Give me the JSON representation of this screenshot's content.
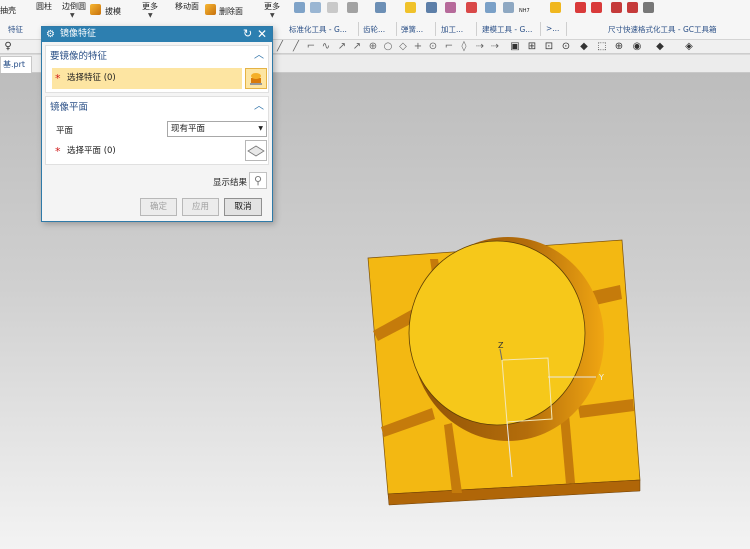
{
  "ribbon": {
    "items": {
      "shell": "抽壳",
      "cylinder": "圆柱",
      "edge_blend": "边倒圆",
      "draft": "拔模",
      "more1": "更多",
      "move_face": "移动面",
      "delete_face": "删除面",
      "more2": "更多"
    },
    "groups": {
      "feature": "特征",
      "std_tools": "标准化工具 - G...",
      "gear": "齿轮...",
      "spring": "弹簧...",
      "machining": "加工...",
      "modeling_tools": "建模工具 - G...",
      "overflow": ">...",
      "dim_format": "尺寸快速格式化工具 - GC工具箱"
    },
    "icon_text": {
      "nh": "NH7"
    }
  },
  "tab": {
    "file_label": "基.prt"
  },
  "dialog": {
    "title": "镜像特征",
    "section1": {
      "title": "要镜像的特征",
      "select_label": "选择特征 (0)"
    },
    "section2": {
      "title": "镜像平面",
      "plane_label": "平面",
      "plane_value": "现有平面",
      "select_plane_label": "选择平面 (0)"
    },
    "show_result": "显示结果",
    "buttons": {
      "ok": "确定",
      "apply": "应用",
      "cancel": "取消"
    }
  },
  "viewport": {
    "axis_labels": {
      "z": "Z",
      "y": "Y"
    }
  },
  "colors": {
    "title_bar": "#2d7fb0",
    "section_header": "#2a4f86",
    "active_row": "#fde5a2",
    "model_yellow": "#f5c518",
    "model_dark": "#b96f0a"
  }
}
